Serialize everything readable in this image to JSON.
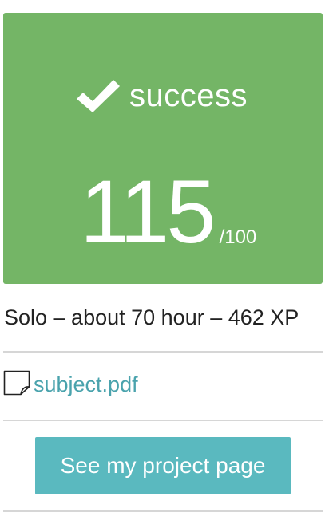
{
  "result": {
    "status_icon": "checkmark-icon",
    "status_label": "success",
    "score": "115",
    "max_score": "/100",
    "card_color": "#74b566"
  },
  "project_meta": {
    "text": "Solo – about 70 hour – 462 XP"
  },
  "attachment": {
    "icon": "document-icon",
    "label": "subject.pdf",
    "link_color": "#4aa3ad"
  },
  "actions": {
    "project_page_label": "See my project page",
    "button_color": "#5ab9bf"
  }
}
